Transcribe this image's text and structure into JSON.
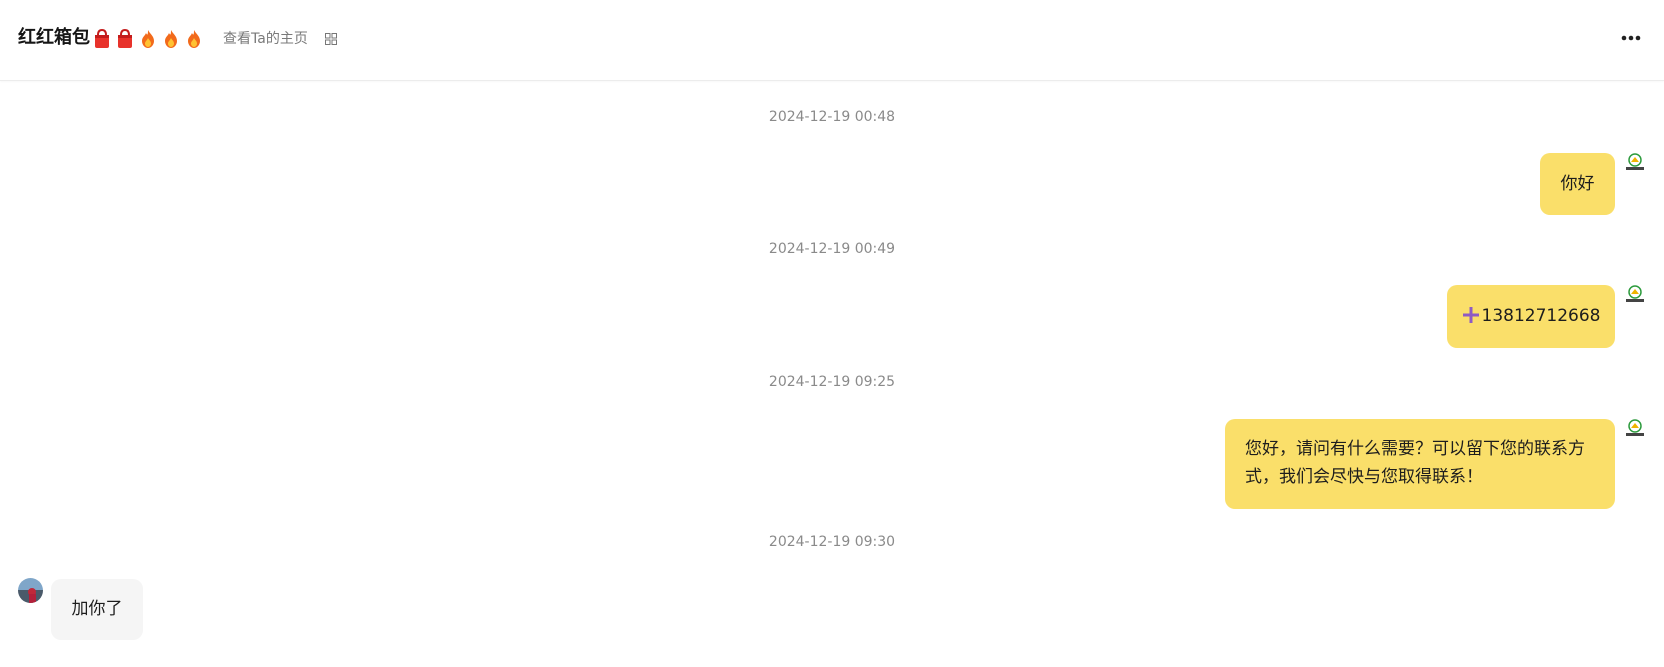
{
  "header": {
    "shop_name": "红红箱包",
    "badges": [
      "bag-icon",
      "bag-icon",
      "flame-icon",
      "flame-icon",
      "flame-icon"
    ],
    "view_home_label": "查看Ta的主页",
    "qr_icon": "grid-icon",
    "more_icon": "more-dots-icon"
  },
  "messages": [
    {
      "timestamp": "2024-12-19 00:48",
      "side": "right",
      "text": "你好"
    },
    {
      "timestamp": "2024-12-19 00:49",
      "side": "right",
      "text": "13812712668",
      "icon": "plus-icon"
    },
    {
      "timestamp": "2024-12-19 09:25",
      "side": "right",
      "text": "您好，请问有什么需要？可以留下您的联系方式，我们会尽快与您取得联系！"
    },
    {
      "timestamp": "2024-12-19 09:30",
      "side": "left",
      "text": "加你了"
    }
  ],
  "colors": {
    "self_bubble": "#fadf6a",
    "other_bubble": "#f5f5f5",
    "plus_icon": "#8e5bc4"
  }
}
